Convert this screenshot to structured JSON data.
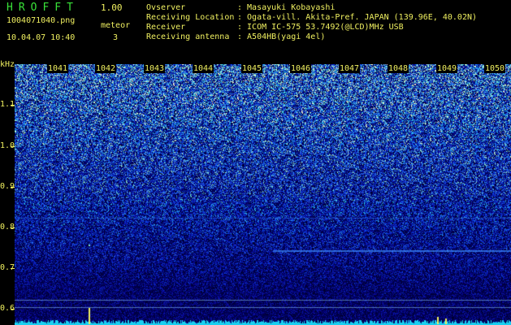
{
  "header": {
    "app_title": "HROFFT",
    "app_version": "1.00",
    "file_name": "1004071040.png",
    "datetime": "10.04.07 10:40",
    "meteor_label": "meteor",
    "meteor_count": "3"
  },
  "info": [
    {
      "key": "Ovserver",
      "value": ": Masayuki Kobayashi"
    },
    {
      "key": "Receiving Location",
      "value": ": Ogata-vill. Akita-Pref. JAPAN (139.96E, 40.02N)"
    },
    {
      "key": "Receiver",
      "value": ": ICOM IC-575 53.7492(@LCD)MHz USB"
    },
    {
      "key": "Receiving antenna",
      "value": ": A504HB(yagi 4el)"
    }
  ],
  "axes": {
    "y_unit": "kHz",
    "y_ticks": [
      "1.1",
      "1.0",
      "0.9",
      "0.8",
      "0.7",
      "0.6"
    ],
    "x_ticks": [
      "1041",
      "1042",
      "1043",
      "1044",
      "1045",
      "1046",
      "1047",
      "1048",
      "1049",
      "1050"
    ]
  },
  "colors": {
    "background": "#000000",
    "text": "#f0f060",
    "title": "#39e339",
    "noise_low": "#0b1a78",
    "noise_high": "#7fe0d0",
    "signal_line": "#3a8cff",
    "baseline": "#19d0f0"
  }
}
